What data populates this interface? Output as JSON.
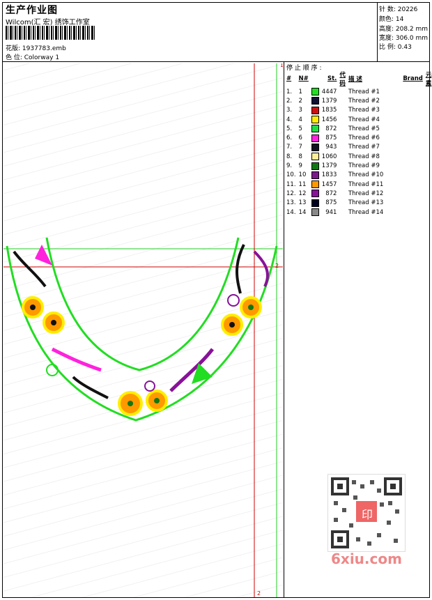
{
  "header": {
    "title": "生产作业图",
    "subtitle": "Wilcom(汇 宏) 绣饰工作室",
    "design_label": "花版: 1937783.emb",
    "colorway_label": "色 位: Colorway 1"
  },
  "stats": {
    "stitches": "针 数: 20226",
    "colors": "颜色: 14",
    "height": "高度: 208.2 mm",
    "width": "宽度: 306.0 mm",
    "scale": "比 例: 0.43"
  },
  "stop_sequence_label": "停 止 顺 序 :",
  "table": {
    "headers": [
      "#",
      "N#",
      "St.",
      "代 码",
      "描 述",
      "Brand",
      "元 素"
    ],
    "rows": [
      {
        "idx": "1.",
        "n": "1",
        "color": "#22dd22",
        "st": "4447",
        "desc": "Thread #1"
      },
      {
        "idx": "2.",
        "n": "2",
        "color": "#111133",
        "st": "1379",
        "desc": "Thread #2"
      },
      {
        "idx": "3.",
        "n": "3",
        "color": "#cc1111",
        "st": "1835",
        "desc": "Thread #3"
      },
      {
        "idx": "4.",
        "n": "4",
        "color": "#ffee00",
        "st": "1456",
        "desc": "Thread #4"
      },
      {
        "idx": "5.",
        "n": "5",
        "color": "#22dd44",
        "st": "872",
        "desc": "Thread #5"
      },
      {
        "idx": "6.",
        "n": "6",
        "color": "#ff22dd",
        "st": "875",
        "desc": "Thread #6"
      },
      {
        "idx": "7.",
        "n": "7",
        "color": "#111122",
        "st": "943",
        "desc": "Thread #7"
      },
      {
        "idx": "8.",
        "n": "8",
        "color": "#ffee99",
        "st": "1060",
        "desc": "Thread #8"
      },
      {
        "idx": "9.",
        "n": "9",
        "color": "#117711",
        "st": "1379",
        "desc": "Thread #9"
      },
      {
        "idx": "10.",
        "n": "10",
        "color": "#7a1a8a",
        "st": "1833",
        "desc": "Thread #10"
      },
      {
        "idx": "11.",
        "n": "11",
        "color": "#ff9900",
        "st": "1457",
        "desc": "Thread #11"
      },
      {
        "idx": "12.",
        "n": "12",
        "color": "#881199",
        "st": "872",
        "desc": "Thread #12"
      },
      {
        "idx": "13.",
        "n": "13",
        "color": "#000022",
        "st": "875",
        "desc": "Thread #13"
      },
      {
        "idx": "14.",
        "n": "14",
        "color": "#888888",
        "st": "941",
        "desc": "Thread #14"
      }
    ]
  },
  "markers": {
    "top_right": "1",
    "mid_right": "2",
    "bottom": "2"
  },
  "watermark": "6xiu.com",
  "qr_stamp": "印"
}
